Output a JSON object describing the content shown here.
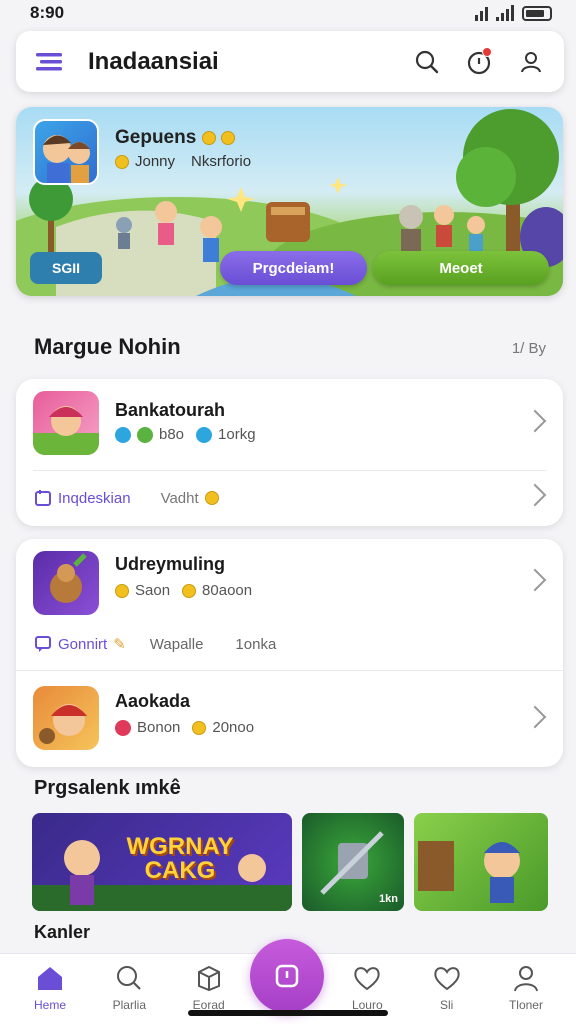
{
  "status": {
    "time": "8:90"
  },
  "header": {
    "title": "Inadaansiai"
  },
  "hero": {
    "title": "Gepuens",
    "sub_a": "Jonny",
    "sub_b": "Nksrforio",
    "small_button": "SGII",
    "primary_button": "Prgcdeiam!",
    "secondary_button": "Meoet"
  },
  "section": {
    "title": "Margue Nohin",
    "link": "1/ By"
  },
  "cards": [
    {
      "title": "Bankatourah",
      "meta": [
        "b8o",
        "1orkg"
      ],
      "foot_label": "Inqdeskian",
      "foot_value": "Vadht"
    },
    {
      "title": "Udreymuling",
      "meta": [
        "Saon",
        "80aoon"
      ],
      "foot_label": "Gonnirt",
      "foot_value": "Wapalle",
      "foot_extra": "1onka"
    },
    {
      "title": "Aaokada",
      "meta": [
        "Bonon",
        "20noo"
      ]
    }
  ],
  "recommend": {
    "title": "Prgsalenk ımkê",
    "tile_main": "WGRNAY CAKG",
    "tile_badge": "1kn",
    "bottom_item": "Kanler"
  },
  "nav": [
    {
      "label": "Heme",
      "icon": "home-icon"
    },
    {
      "label": "Plarlia",
      "icon": "search-icon"
    },
    {
      "label": "Eorad",
      "icon": "box-icon"
    },
    {
      "label": "Louro",
      "icon": "heart-icon"
    },
    {
      "label": "Sli",
      "icon": "heart-outline-icon"
    },
    {
      "label": "Tloner",
      "icon": "user-icon"
    }
  ],
  "colors": {
    "accent": "#6a4fd6",
    "green": "#58a120",
    "fab": "#a63fc7"
  }
}
